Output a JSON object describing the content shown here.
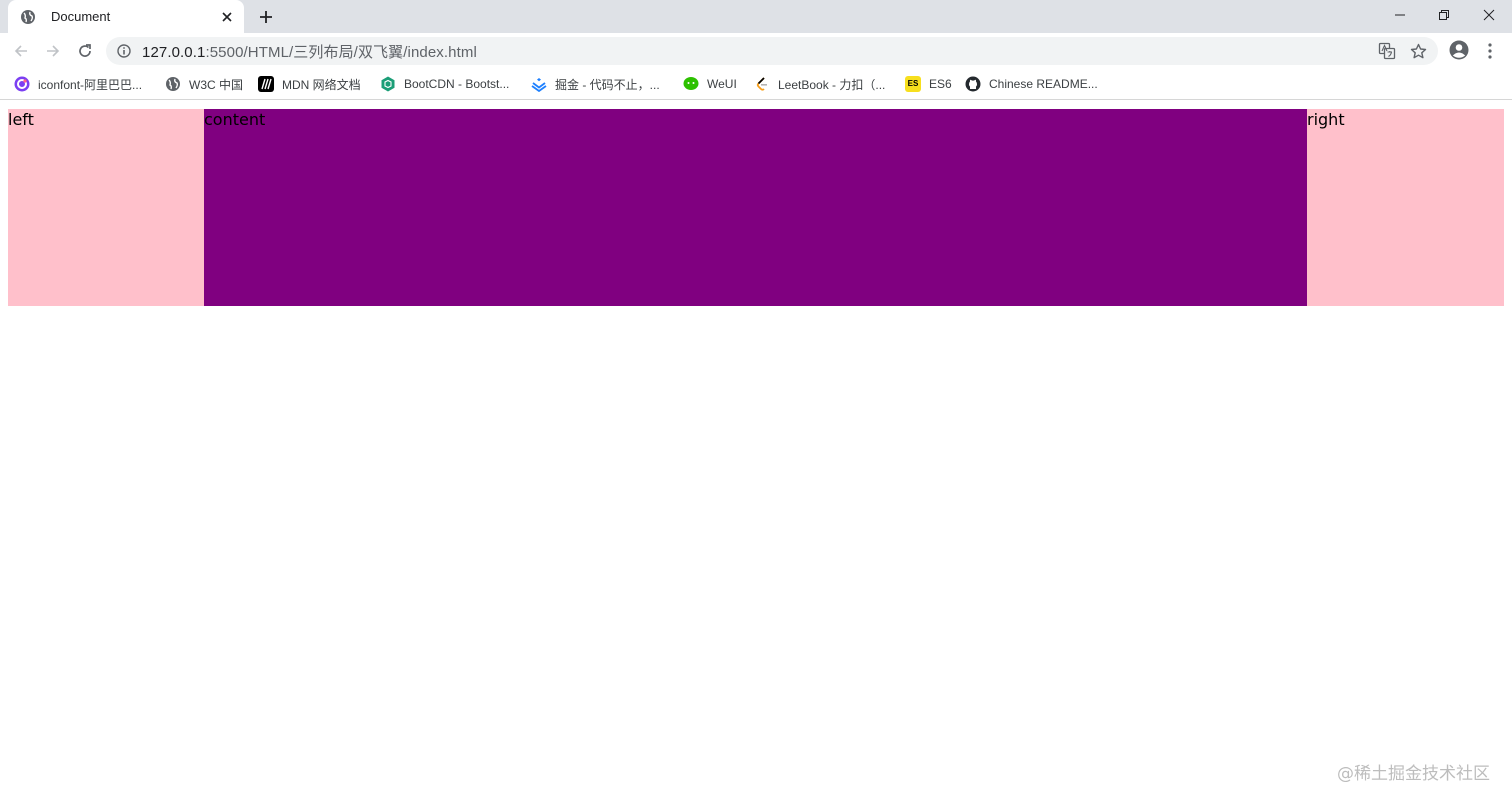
{
  "browser": {
    "tab": {
      "title": "Document"
    },
    "address": {
      "host": "127.0.0.1",
      "path": ":5500/HTML/三列布局/双飞翼/index.html"
    },
    "bookmarks": [
      {
        "label": "iconfont-阿里巴巴...",
        "icon": "iconfont-icon",
        "color": "#7b3ff2"
      },
      {
        "label": "W3C 中国",
        "icon": "globe-icon",
        "color": "#5f6368"
      },
      {
        "label": "MDN 网络文档",
        "icon": "mdn-icon",
        "color": "#000000"
      },
      {
        "label": "BootCDN - Bootst...",
        "icon": "bootcdn-icon",
        "color": "#1b9e77"
      },
      {
        "label": "掘金 - 代码不止，...",
        "icon": "juejin-icon",
        "color": "#1e80ff"
      },
      {
        "label": "WeUI",
        "icon": "weui-icon",
        "color": "#2dc100"
      },
      {
        "label": "LeetBook - 力扣（...",
        "icon": "leetcode-icon",
        "color": "#f89f1b"
      },
      {
        "label": "ES6",
        "icon": "es6-icon",
        "color": "#f7df1e"
      },
      {
        "label": "Chinese README...",
        "icon": "github-icon",
        "color": "#24292e"
      }
    ]
  },
  "page": {
    "left": "left",
    "content": "content",
    "right": "right",
    "colors": {
      "side": "#ffc0cb",
      "center": "#800080"
    }
  },
  "watermark": "@稀土掘金技术社区"
}
